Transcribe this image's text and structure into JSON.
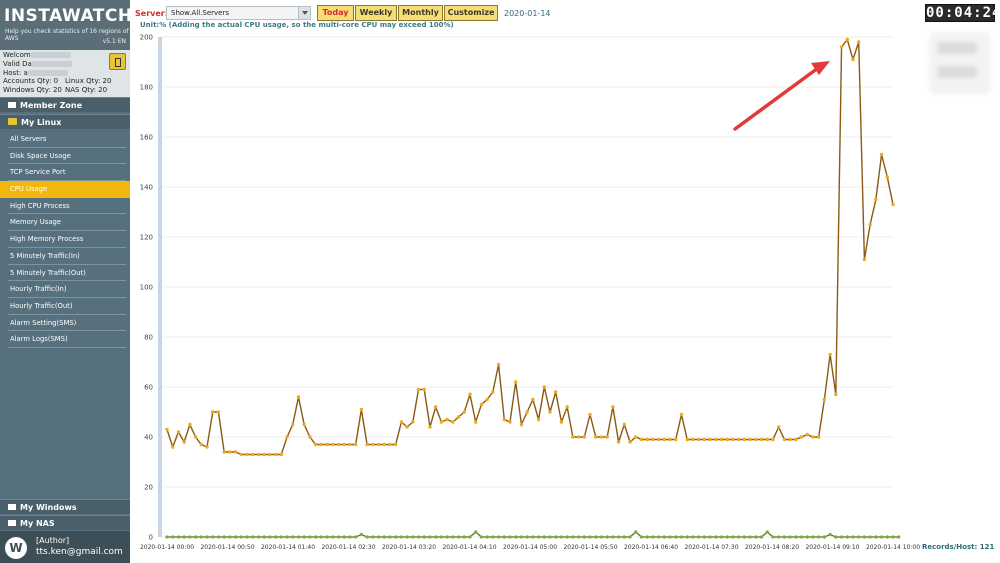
{
  "sidebar": {
    "logo": "INSTAWATCHER",
    "tagline": "Help you check statistics of 16 regions of AWS",
    "version": "v5.1 EN",
    "user": {
      "welcome": "Welcom",
      "valid": "Valid Da",
      "host": "Host: a",
      "accounts_qty": "Accounts Qty: 0",
      "linux_qty": "Linux Qty: 20",
      "windows_qty": "Windows Qty: 20",
      "nas_qty": "NAS Qty: 20"
    },
    "member_zone": "Member Zone",
    "my_linux": "My Linux",
    "menu": [
      {
        "label": "All Servers"
      },
      {
        "label": "Disk Space Usage"
      },
      {
        "label": "TCP Service Port"
      },
      {
        "label": "CPU Usage"
      },
      {
        "label": "High CPU Process"
      },
      {
        "label": "Memory Usage"
      },
      {
        "label": "High Memory Process"
      },
      {
        "label": "5 Minutely Traffic(In)"
      },
      {
        "label": "5 Minutely Traffic(Out)"
      },
      {
        "label": "Hourly Traffic(In)"
      },
      {
        "label": "Hourly Traffic(Out)"
      },
      {
        "label": "Alarm Setting(SMS)"
      },
      {
        "label": "Alarm Logs(SMS)"
      }
    ],
    "active_index": 3,
    "my_windows": "My Windows",
    "my_nas": "My NAS",
    "author_role": "[Author]",
    "author_email": "tts.ken@gmail.com"
  },
  "toolbar": {
    "server_label": "Server:",
    "server_value": "Show.All.Servers",
    "ranges": [
      "Today",
      "Weekly",
      "Monthly",
      "Customize"
    ],
    "active_range": "Today",
    "date": "2020-01-14",
    "unit_note": "Unit:% (Adding the actual CPU usage, so the multi-core CPU may exceed 100%)",
    "clock": "00:04:24"
  },
  "records": "Records/Host: 121",
  "colors": {
    "accent": "#f2b70f",
    "line": "#8a5a14",
    "marker": "#f2a81d",
    "green": "#7fa832",
    "arrow": "#e03a3a"
  },
  "chart_data": {
    "type": "line",
    "ylim": [
      0,
      200
    ],
    "yticks": [
      0,
      20,
      40,
      60,
      80,
      100,
      120,
      140,
      160,
      180,
      200
    ],
    "xticks": [
      "2020-01-14 00:00",
      "2020-01-14 00:50",
      "2020-01-14 01:40",
      "2020-01-14 02:30",
      "2020-01-14 03:20",
      "2020-01-14 04:10",
      "2020-01-14 05:00",
      "2020-01-14 05:50",
      "2020-01-14 06:40",
      "2020-01-14 07:30",
      "2020-01-14 08:20",
      "2020-01-14 09:10",
      "2020-01-14 10:00"
    ],
    "series": [
      {
        "values": [
          43,
          36,
          42,
          38,
          45,
          40,
          37,
          36,
          50,
          50,
          34,
          34,
          34,
          33,
          33,
          33,
          33,
          33,
          33,
          33,
          33,
          40,
          45,
          56,
          45,
          40,
          37,
          37,
          37,
          37,
          37,
          37,
          37,
          37,
          51,
          37,
          37,
          37,
          37,
          37,
          37,
          46,
          44,
          46,
          59,
          59,
          44,
          52,
          46,
          47,
          46,
          48,
          50,
          57,
          46,
          53,
          55,
          58,
          69,
          47,
          46,
          62,
          45,
          50,
          55,
          47,
          60,
          50,
          58,
          46,
          52,
          40,
          40,
          40,
          49,
          40,
          40,
          40,
          52,
          38,
          45,
          38,
          40,
          39,
          39,
          39,
          39,
          39,
          39,
          39,
          49,
          39,
          39,
          39,
          39,
          39,
          39,
          39,
          39,
          39,
          39,
          39,
          39,
          39,
          39,
          39,
          39,
          44,
          39,
          39,
          39,
          40,
          41,
          40,
          40,
          55,
          73,
          57,
          196,
          199,
          191,
          198,
          111,
          125,
          135,
          153,
          144,
          133
        ]
      },
      {
        "values": [
          0,
          0,
          0,
          0,
          0,
          0,
          0,
          0,
          0,
          0,
          0,
          0,
          0,
          0,
          0,
          0,
          0,
          0,
          0,
          0,
          0,
          0,
          0,
          0,
          0,
          0,
          0,
          0,
          0,
          0,
          0,
          0,
          0,
          0,
          1,
          0,
          0,
          0,
          0,
          0,
          0,
          0,
          0,
          0,
          0,
          0,
          0,
          0,
          0,
          0,
          0,
          0,
          0,
          0,
          2,
          0,
          0,
          0,
          0,
          0,
          0,
          0,
          0,
          0,
          0,
          0,
          0,
          0,
          0,
          0,
          0,
          0,
          0,
          0,
          0,
          0,
          0,
          0,
          0,
          0,
          0,
          0,
          2,
          0,
          0,
          0,
          0,
          0,
          0,
          0,
          0,
          0,
          0,
          0,
          0,
          0,
          0,
          0,
          0,
          0,
          0,
          0,
          0,
          0,
          0,
          2,
          0,
          0,
          0,
          0,
          0,
          0,
          0,
          0,
          0,
          0,
          1,
          0,
          0,
          0,
          0,
          0,
          0,
          0,
          0,
          0,
          0,
          0,
          0
        ]
      }
    ]
  }
}
